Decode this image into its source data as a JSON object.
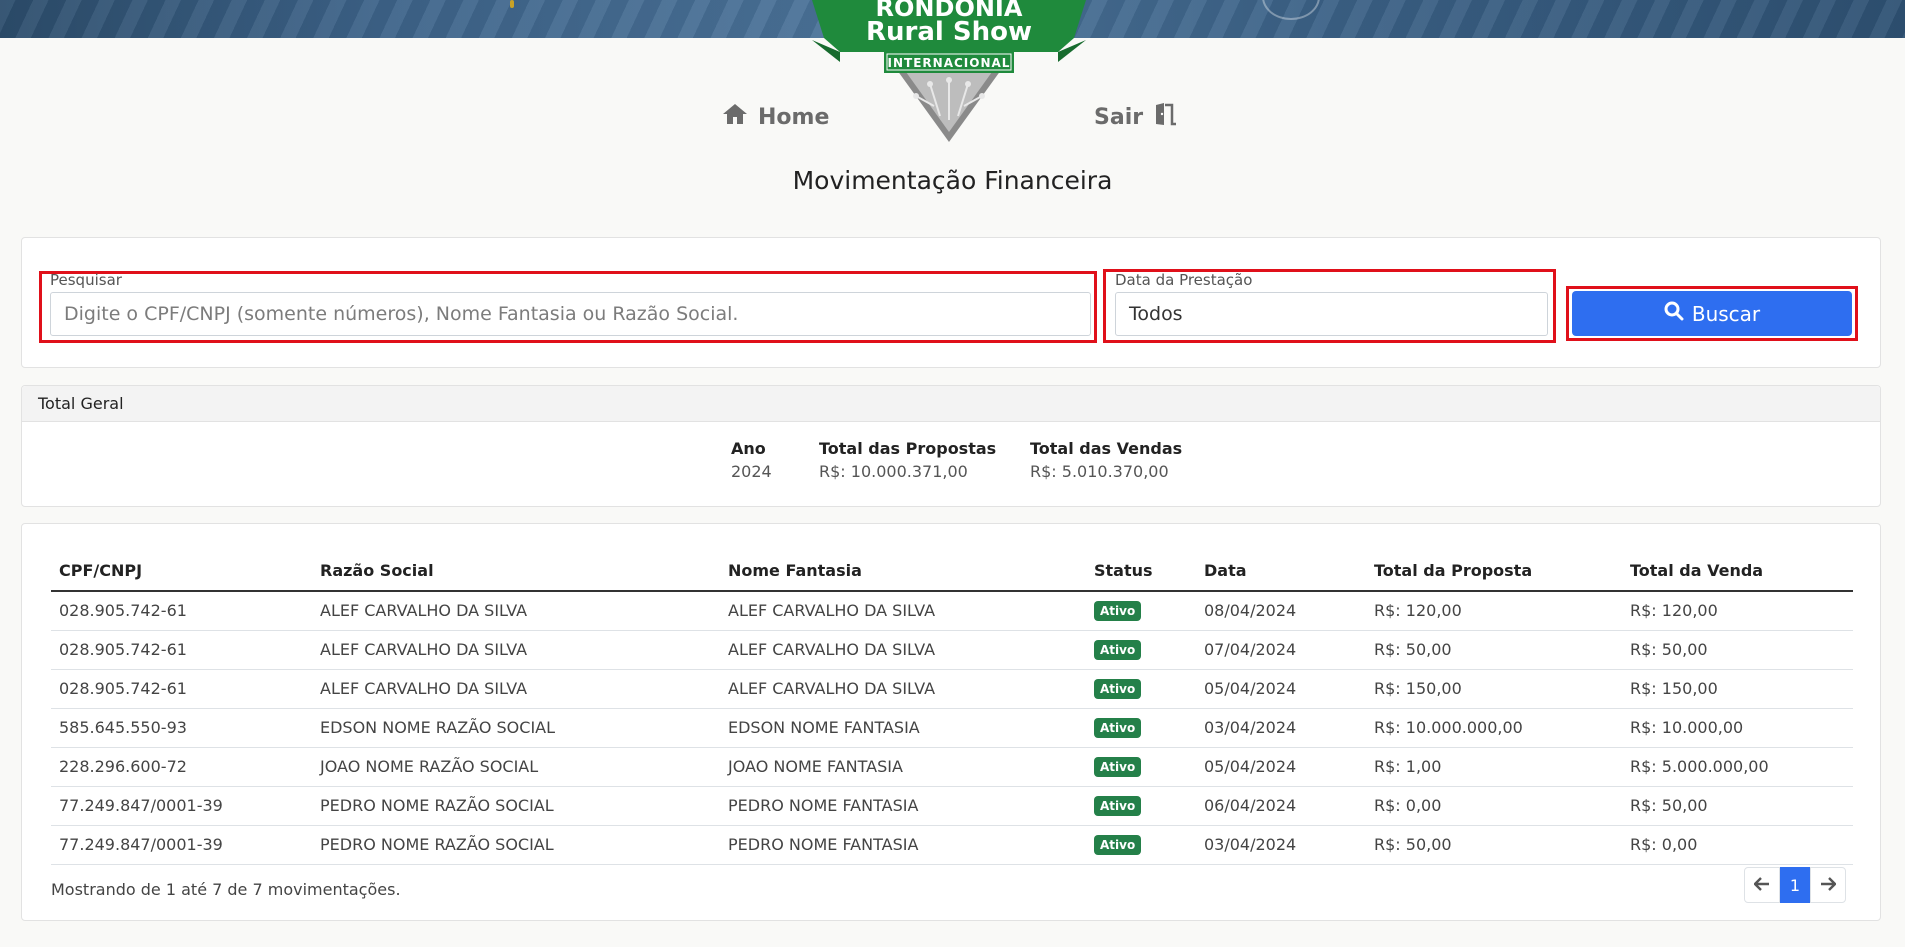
{
  "brand": {
    "logo_line1": "RONDÔNIA",
    "logo_line2": "Rural Show",
    "logo_ribbon": "INTERNACIONAL",
    "green": "#1f8a3c",
    "dark_green": "#176b2e"
  },
  "nav": {
    "home_label": "Home",
    "home_icon": "home-icon",
    "exit_label": "Sair",
    "exit_icon": "door-exit-icon"
  },
  "page": {
    "title": "Movimentação Financeira"
  },
  "search": {
    "label": "Pesquisar",
    "placeholder": "Digite o CPF/CNPJ (somente números), Nome Fantasia ou Razão Social.",
    "date_label": "Data da Prestação",
    "date_value": "Todos",
    "button_label": "Buscar",
    "button_icon": "search-icon",
    "button_color": "#2e6ef0"
  },
  "totals": {
    "header": "Total Geral",
    "ano_label": "Ano",
    "ano_value": "2024",
    "propostas_label": "Total das Propostas",
    "propostas_value": "R$: 10.000.371,00",
    "vendas_label": "Total das Vendas",
    "vendas_value": "R$: 5.010.370,00"
  },
  "table": {
    "columns": [
      "CPF/CNPJ",
      "Razão Social",
      "Nome Fantasia",
      "Status",
      "Data",
      "Total da Proposta",
      "Total da Venda"
    ],
    "rows": [
      [
        "028.905.742-61",
        "ALEF CARVALHO DA SILVA",
        "ALEF CARVALHO DA SILVA",
        "Ativo",
        "08/04/2024",
        "R$: 120,00",
        "R$: 120,00"
      ],
      [
        "028.905.742-61",
        "ALEF CARVALHO DA SILVA",
        "ALEF CARVALHO DA SILVA",
        "Ativo",
        "07/04/2024",
        "R$: 50,00",
        "R$: 50,00"
      ],
      [
        "028.905.742-61",
        "ALEF CARVALHO DA SILVA",
        "ALEF CARVALHO DA SILVA",
        "Ativo",
        "05/04/2024",
        "R$: 150,00",
        "R$: 150,00"
      ],
      [
        "585.645.550-93",
        "EDSON NOME RAZÃO SOCIAL",
        "EDSON NOME FANTASIA",
        "Ativo",
        "03/04/2024",
        "R$: 10.000.000,00",
        "R$: 10.000,00"
      ],
      [
        "228.296.600-72",
        "JOAO NOME RAZÃO SOCIAL",
        "JOAO NOME FANTASIA",
        "Ativo",
        "05/04/2024",
        "R$: 1,00",
        "R$: 5.000.000,00"
      ],
      [
        "77.249.847/0001-39",
        "PEDRO NOME RAZÃO SOCIAL",
        "PEDRO NOME FANTASIA",
        "Ativo",
        "06/04/2024",
        "R$: 0,00",
        "R$: 50,00"
      ],
      [
        "77.249.847/0001-39",
        "PEDRO NOME RAZÃO SOCIAL",
        "PEDRO NOME FANTASIA",
        "Ativo",
        "03/04/2024",
        "R$: 50,00",
        "R$: 0,00"
      ]
    ],
    "status_color": "#248049",
    "footer": "Mostrando de 1 até 7 de 7 movimentações.",
    "pagination": {
      "prev_icon": "arrow-left-icon",
      "page": "1",
      "next_icon": "arrow-right-icon"
    }
  }
}
